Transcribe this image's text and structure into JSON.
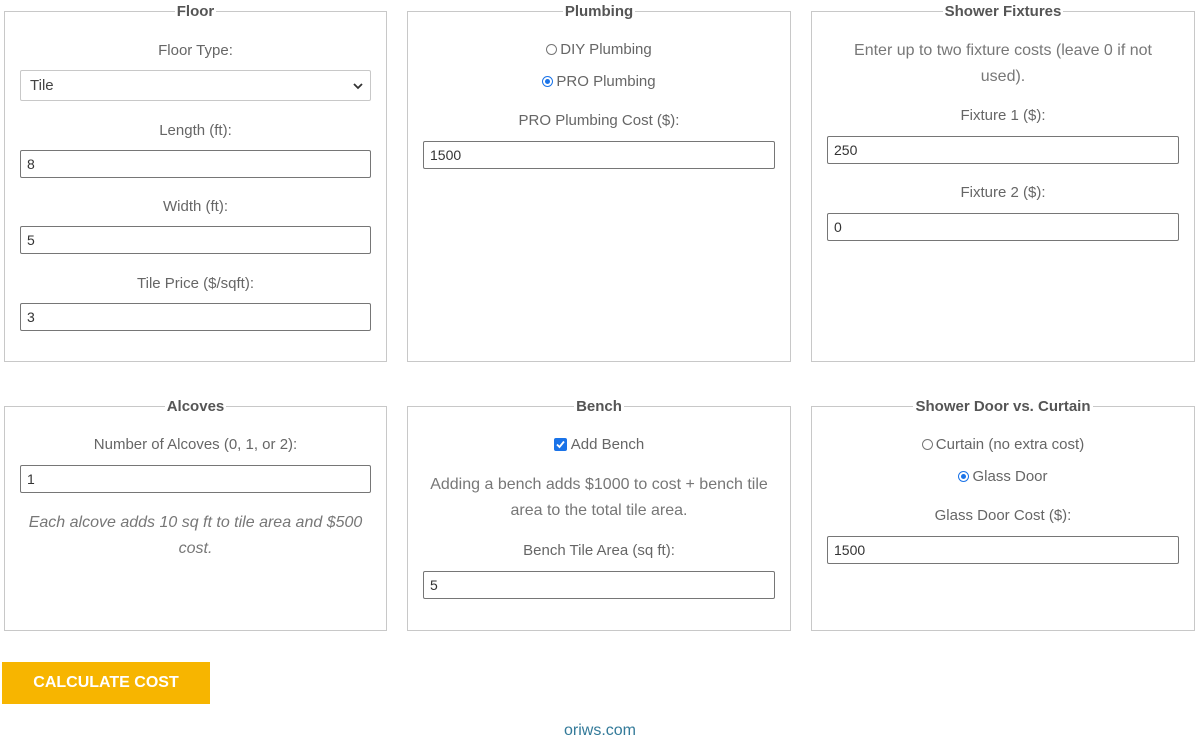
{
  "floor": {
    "legend": "Floor",
    "type_label": "Floor Type:",
    "type_value": "Tile",
    "length_label": "Length (ft):",
    "length_value": "8",
    "width_label": "Width (ft):",
    "width_value": "5",
    "price_label": "Tile Price ($/sqft):",
    "price_value": "3"
  },
  "plumbing": {
    "legend": "Plumbing",
    "options": [
      {
        "label": "DIY Plumbing",
        "selected": false
      },
      {
        "label": "PRO Plumbing",
        "selected": true
      }
    ],
    "cost_label": "PRO Plumbing Cost ($):",
    "cost_value": "1500"
  },
  "fixtures": {
    "legend": "Shower Fixtures",
    "note": "Enter up to two fixture costs (leave 0 if not used).",
    "fixture1_label": "Fixture 1 ($):",
    "fixture1_value": "250",
    "fixture2_label": "Fixture 2 ($):",
    "fixture2_value": "0"
  },
  "alcoves": {
    "legend": "Alcoves",
    "count_label": "Number of Alcoves (0, 1, or 2):",
    "count_value": "1",
    "note": "Each alcove adds 10 sq ft to tile area and $500 cost."
  },
  "bench": {
    "legend": "Bench",
    "add_label": "Add Bench",
    "add_checked": true,
    "note": "Adding a bench adds $1000 to cost + bench tile area to the total tile area.",
    "area_label": "Bench Tile Area (sq ft):",
    "area_value": "5"
  },
  "door": {
    "legend": "Shower Door vs. Curtain",
    "options": [
      {
        "label": "Curtain (no extra cost)",
        "selected": false
      },
      {
        "label": "Glass Door",
        "selected": true
      }
    ],
    "cost_label": "Glass Door Cost ($):",
    "cost_value": "1500"
  },
  "calculate_label": "CALCULATE COST",
  "footer_link": "oriws.com",
  "colors": {
    "accent": "#f7b500",
    "radio": "#1a73e8",
    "link": "#337a99"
  }
}
